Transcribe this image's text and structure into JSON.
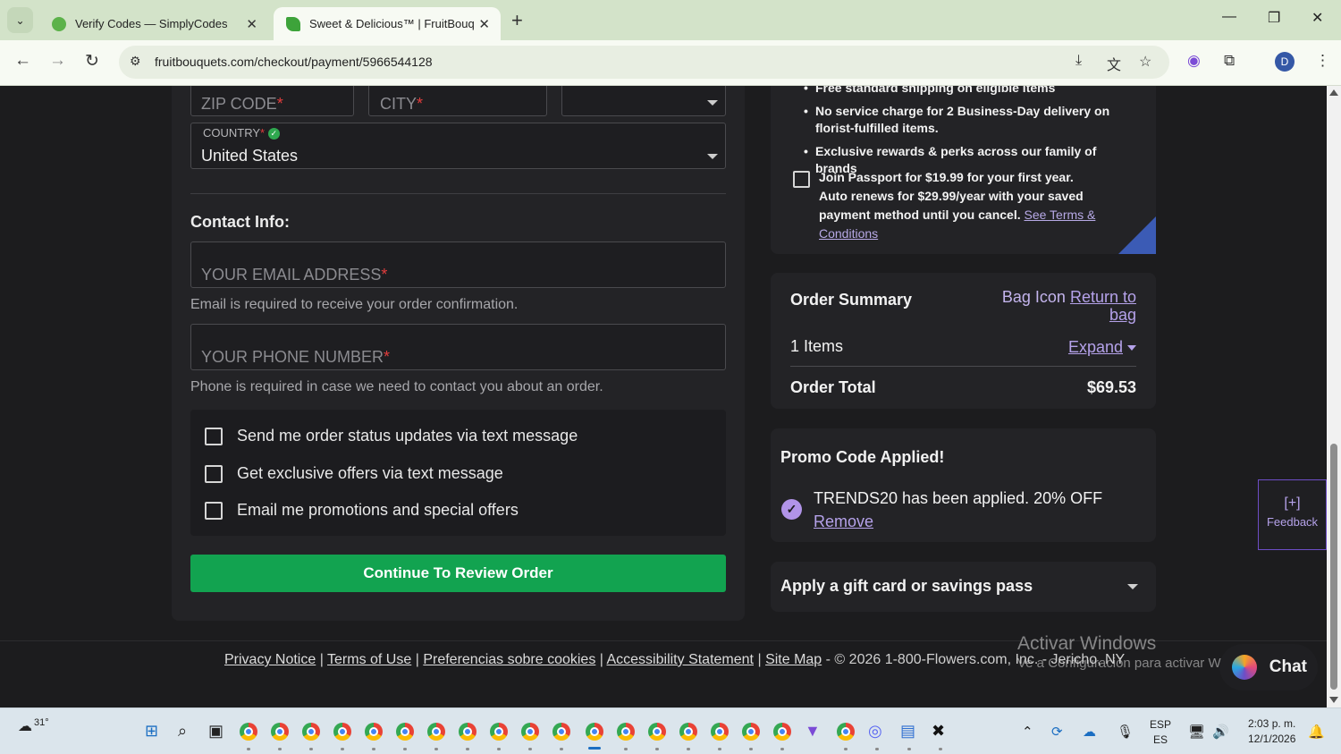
{
  "browser": {
    "tabs": [
      {
        "title": "Verify Codes — SimplyCodes",
        "active": false
      },
      {
        "title": "Sweet & Delicious™ | FruitBouquets",
        "active": true
      }
    ],
    "url": "fruitbouquets.com/checkout/payment/5966544128",
    "profile_initial": "D"
  },
  "form": {
    "zip_placeholder": "ZIP CODE",
    "city_placeholder": "CITY",
    "required_mark": "*",
    "country_label": "COUNTRY",
    "country_value": "United States",
    "contact_heading": "Contact Info:",
    "email_placeholder": "YOUR EMAIL ADDRESS",
    "email_help": "Email is required to receive your order confirmation.",
    "phone_placeholder": "YOUR PHONE NUMBER",
    "phone_help": "Phone is required in case we need to contact you about an order.",
    "options": [
      {
        "label": "Send me order status updates via text message",
        "checked": false
      },
      {
        "label": "Get exclusive offers via text message",
        "checked": false
      },
      {
        "label": "Email me promotions and special offers",
        "checked": false
      }
    ],
    "continue_label": "Continue To Review Order"
  },
  "passport": {
    "benefits": [
      "Free standard shipping on eligible items",
      "No service charge for 2 Business-Day delivery on florist-fulfilled items.",
      "Exclusive rewards & perks across our family of brands"
    ],
    "join_text": "Join Passport for $19.99 for your first year.",
    "renew_text": "Auto renews for $29.99/year with your saved payment method until you cancel.",
    "terms_link": "See Terms & Conditions"
  },
  "order_summary": {
    "title": "Order Summary",
    "bag_icon_alt": "Bag Icon",
    "return_link": "Return to bag",
    "items_label": "1 Items",
    "expand_label": "Expand",
    "total_label": "Order Total",
    "total_value": "$69.53"
  },
  "promo": {
    "heading": "Promo Code Applied!",
    "message": "TRENDS20 has been applied. 20% OFF",
    "remove_label": "Remove"
  },
  "gift": {
    "label": "Apply a gift card or savings pass"
  },
  "feedback": {
    "icon": "[+]",
    "label": "Feedback"
  },
  "footer": {
    "links": [
      "Privacy Notice",
      "Terms of Use",
      "Preferencias sobre cookies",
      "Accessibility Statement",
      "Site Map"
    ],
    "separator": "|",
    "copyright": "- © 2026 1-800-Flowers.com, Inc. - Jericho, NY"
  },
  "windows_watermark": {
    "line1": "Activar Windows",
    "line2": "Ve a Configuración para activar Windows."
  },
  "chat": {
    "label": "Chat"
  },
  "taskbar": {
    "weather_temp": "31°",
    "lang_line1": "ESP",
    "lang_line2": "ES",
    "time": "2:03 p. m.",
    "date": "12/1/2026"
  },
  "colors": {
    "cta": "#12a350",
    "accent": "#b5a2ea",
    "background": "#1c1c1e"
  }
}
